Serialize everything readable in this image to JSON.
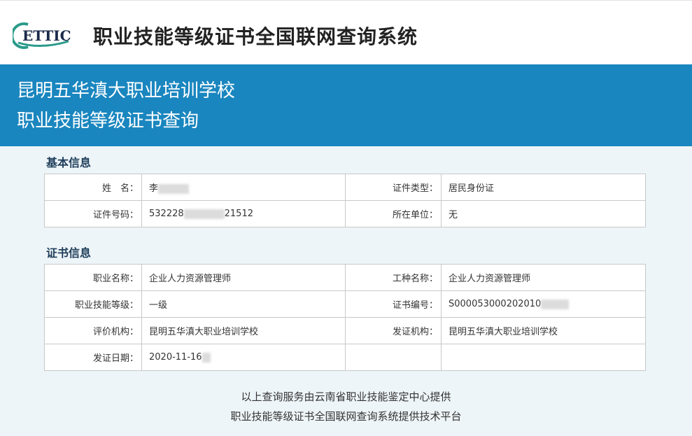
{
  "header": {
    "logo_text": "ETTIC",
    "site_title": "职业技能等级证书全国联网查询系统"
  },
  "banner": {
    "org_name": "昆明五华滇大职业培训学校",
    "page_title": "职业技能等级证书查询"
  },
  "basic_info": {
    "title": "基本信息",
    "name_label": "姓　名：",
    "name_value": "李",
    "id_type_label": "证件类型：",
    "id_type_value": "居民身份证",
    "id_number_label": "证件号码：",
    "id_number_prefix": "532228",
    "id_number_suffix": "21512",
    "unit_label": "所在单位：",
    "unit_value": "无"
  },
  "cert_info": {
    "title": "证书信息",
    "occupation_label": "职业名称：",
    "occupation_value": "企业人力资源管理师",
    "job_type_label": "工种名称：",
    "job_type_value": "企业人力资源管理师",
    "level_label": "职业技能等级：",
    "level_value": "一级",
    "cert_no_label": "证书编号：",
    "cert_no_value": "S000053000202010",
    "eval_org_label": "评价机构：",
    "eval_org_value": "昆明五华滇大职业培训学校",
    "issue_org_label": "发证机构：",
    "issue_org_value": "昆明五华滇大职业培训学校",
    "issue_date_label": "发证日期：",
    "issue_date_value": "2020-11-16"
  },
  "footer": {
    "line1": "以上查询服务由云南省职业技能鉴定中心提供",
    "line2": "职业技能等级证书全国联网查询系统提供技术平台"
  }
}
